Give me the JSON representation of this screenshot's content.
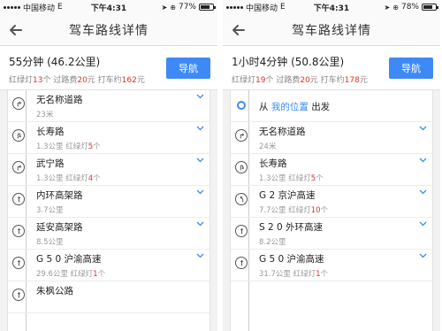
{
  "left": {
    "status": {
      "carrier": "中国移动",
      "network": "E",
      "time": "下午4:31",
      "battery": "77%",
      "battery_level": 0.77
    },
    "nav": {
      "title": "驾车路线详情"
    },
    "summary": {
      "title": "55分钟 (46.2公里)",
      "detail": [
        {
          "t": "红绿灯",
          "c": "gray"
        },
        {
          "t": "13",
          "c": "red"
        },
        {
          "t": "个 过路费",
          "c": "gray"
        },
        {
          "t": "20",
          "c": "red"
        },
        {
          "t": "元 打车约",
          "c": "gray"
        },
        {
          "t": "162",
          "c": "red"
        },
        {
          "t": "元",
          "c": "gray"
        }
      ],
      "button": "导航"
    },
    "steps": [
      {
        "icon": "turn-right-icon",
        "name": "无名称道路",
        "distance": "23米",
        "lights": null
      },
      {
        "icon": "uturn-icon",
        "name": "长寿路",
        "distance": "1.3公里",
        "lights": {
          "pre": "红绿灯",
          "n": "5",
          "post": "个"
        }
      },
      {
        "icon": "turn-right-icon",
        "name": "武宁路",
        "distance": "1.3公里",
        "lights": {
          "pre": "红绿灯",
          "n": "4",
          "post": "个"
        }
      },
      {
        "icon": "straight-icon",
        "name": "内环高架路",
        "distance": "3.7公里",
        "lights": null
      },
      {
        "icon": "straight-icon",
        "name": "延安高架路",
        "distance": "8.5公里",
        "lights": null
      },
      {
        "icon": "straight-icon",
        "name": "G 5 0 沪渝高速",
        "distance": "29.6公里",
        "lights": {
          "pre": "红绿灯",
          "n": "1",
          "post": "个"
        }
      },
      {
        "icon": "straight-icon",
        "name": "朱枫公路",
        "distance": "",
        "lights": null
      }
    ]
  },
  "right": {
    "status": {
      "carrier": "中国移动",
      "network": "E",
      "time": "下午4:31",
      "battery": "78%",
      "battery_level": 0.78
    },
    "nav": {
      "title": "驾车路线详情"
    },
    "summary": {
      "title": "1小时4分钟 (50.8公里)",
      "detail": [
        {
          "t": "红绿灯",
          "c": "gray"
        },
        {
          "t": "19",
          "c": "red"
        },
        {
          "t": "个 过路费",
          "c": "gray"
        },
        {
          "t": "20",
          "c": "red"
        },
        {
          "t": "元 打车约",
          "c": "gray"
        },
        {
          "t": "178",
          "c": "red"
        },
        {
          "t": "元",
          "c": "gray"
        }
      ],
      "button": "导航"
    },
    "start": {
      "from": "从",
      "place": "我的位置",
      "action": "出发"
    },
    "steps": [
      {
        "icon": "turn-right-icon",
        "name": "无名称道路",
        "distance": "24米",
        "lights": null
      },
      {
        "icon": "uturn-icon",
        "name": "长寿路",
        "distance": "1.3公里",
        "lights": {
          "pre": "红绿灯",
          "n": "5",
          "post": "个"
        }
      },
      {
        "icon": "slight-left-icon",
        "name": "G 2 京沪高速",
        "distance": "7.7公里",
        "lights": {
          "pre": "红绿灯",
          "n": "10",
          "post": "个"
        }
      },
      {
        "icon": "straight-icon",
        "name": "S 2 0 外环高速",
        "distance": "8.2公里",
        "lights": null
      },
      {
        "icon": "straight-icon",
        "name": "G 5 0 沪渝高速",
        "distance": "31.7公里",
        "lights": {
          "pre": "红绿灯",
          "n": "1",
          "post": "个"
        }
      }
    ]
  },
  "colors": {
    "accent": "#3d8af7",
    "highlight": "#e03030",
    "muted": "#999999"
  }
}
